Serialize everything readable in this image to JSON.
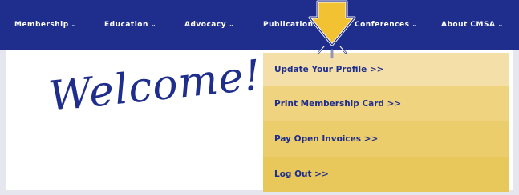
{
  "nav": {
    "items": [
      {
        "label": "Membership"
      },
      {
        "label": "Education"
      },
      {
        "label": "Advocacy"
      },
      {
        "label": "Publications"
      },
      {
        "label": "Conferences"
      },
      {
        "label": "About CMSA"
      }
    ],
    "chevron": "⌄"
  },
  "welcome": {
    "text": "Welcome!"
  },
  "dropdown": {
    "items": [
      {
        "label": "Update Your Profile >>"
      },
      {
        "label": "Print Membership Card >>"
      },
      {
        "label": "Pay Open Invoices >>"
      },
      {
        "label": "Log Out >>"
      }
    ]
  },
  "colors": {
    "nav_bg": "#1f2d8c",
    "brand_blue": "#1f2d8c",
    "dropdown_shades": [
      "#f4dfa8",
      "#efd37e",
      "#eccd6c",
      "#e8c75b"
    ],
    "highlight_arrow": "#f2c233"
  },
  "icons": {
    "pointer": "down-arrow-icon"
  }
}
